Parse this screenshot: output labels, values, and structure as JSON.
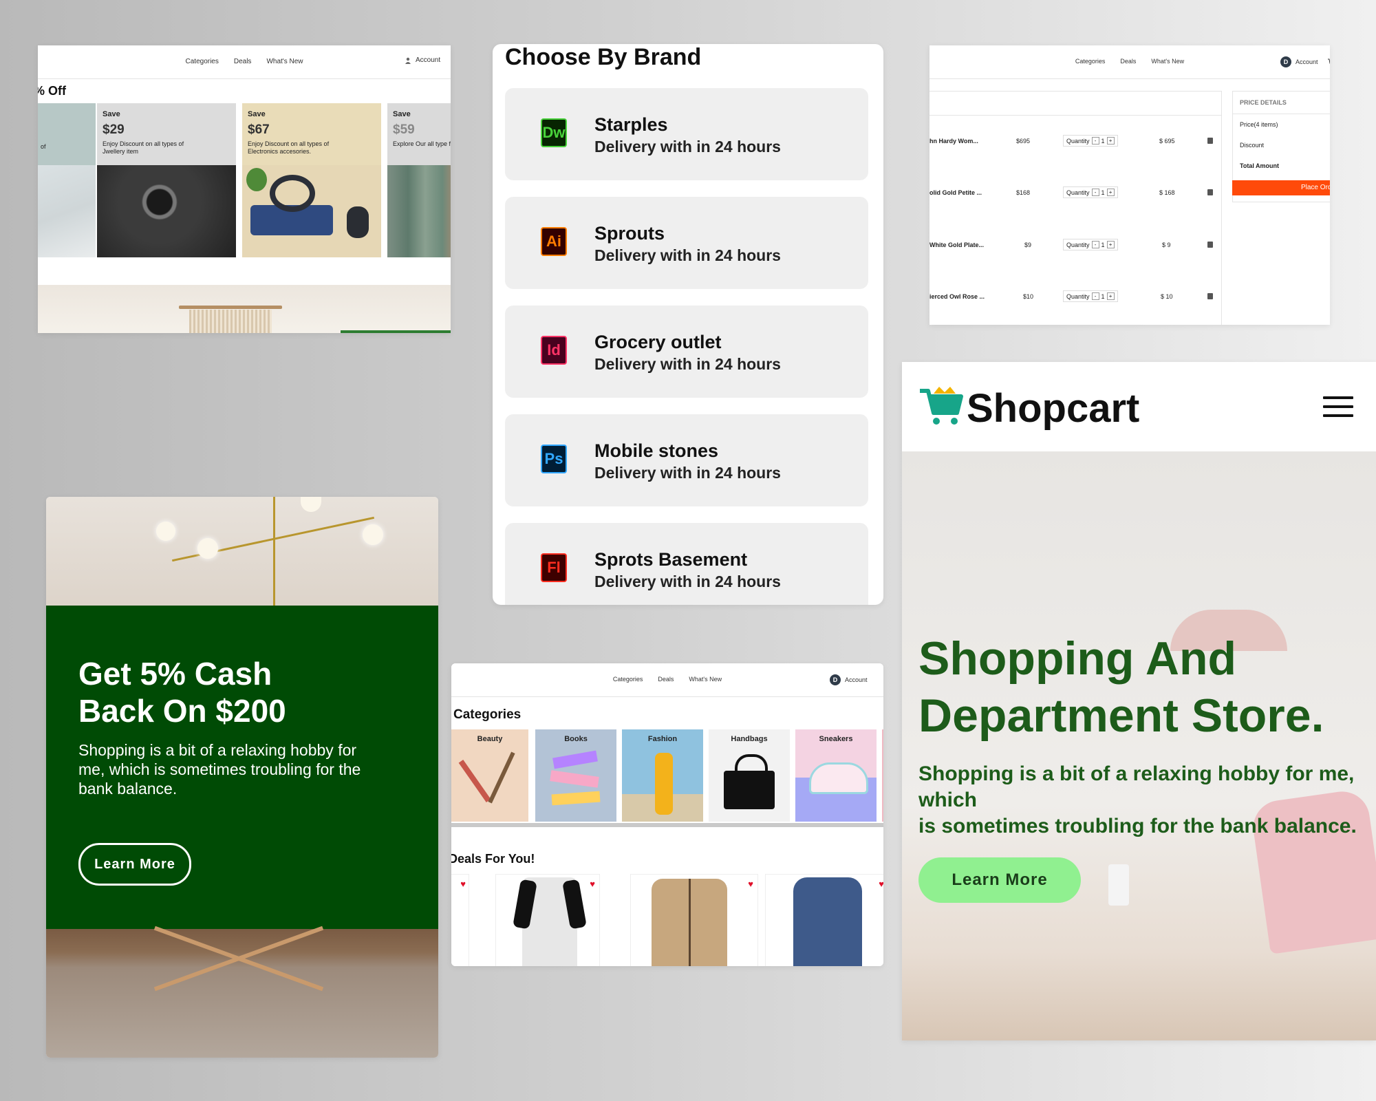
{
  "colors": {
    "hero_green": "#1d5c1a",
    "cashback_green": "#004b05",
    "learn_more_light": "#90f090",
    "place_order": "#ff4a0a",
    "heart": "#e0102a"
  },
  "nav": {
    "categories": "Categories",
    "deals": "Deals",
    "whats_new": "What's New",
    "account": "Account",
    "avatar_initial": "D"
  },
  "deals_card": {
    "off_label": "% Off",
    "partial_desc": "of",
    "deals": [
      {
        "save": "Save",
        "price": "$29",
        "desc": "Enjoy Discount on all types of Jwellery item",
        "image": "jewellery-photo"
      },
      {
        "save": "Save",
        "price": "$67",
        "desc": "Enjoy Discount on all types of Electronics accesories.",
        "image": "headphones-keyboard-photo"
      },
      {
        "save": "Save",
        "price": "$59",
        "desc": "Explore Our all type for Men",
        "image": "clothing-rack-photo"
      }
    ]
  },
  "brands_card": {
    "heading": "Choose By Brand",
    "brands": [
      {
        "icon": "Dw",
        "name": "Starples",
        "sub": "Delivery with in 24 hours",
        "color": "#48d13a",
        "bg": "#072401"
      },
      {
        "icon": "Ai",
        "name": "Sprouts",
        "sub": "Delivery with in 24 hours",
        "color": "#ff7c00",
        "bg": "#330000"
      },
      {
        "icon": "Id",
        "name": "Grocery outlet",
        "sub": "Delivery with in 24 hours",
        "color": "#ff3366",
        "bg": "#49021f"
      },
      {
        "icon": "Ps",
        "name": "Mobile stones",
        "sub": "Delivery with in 24 hours",
        "color": "#31a8ff",
        "bg": "#001e36"
      },
      {
        "icon": "Fl",
        "name": "Sprots Basement",
        "sub": "Delivery with in 24 hours",
        "color": "#ff2d20",
        "bg": "#3d0000"
      }
    ]
  },
  "cart_card": {
    "rows": [
      {
        "name": "hn Hardy Wom...",
        "price": "$695",
        "qty_label": "Quantity",
        "qty": "1",
        "total": "$ 695"
      },
      {
        "name": "olid Gold Petite ...",
        "price": "$168",
        "qty_label": "Quantity",
        "qty": "1",
        "total": "$ 168"
      },
      {
        "name": "White Gold Plate...",
        "price": "$9",
        "qty_label": "Quantity",
        "qty": "1",
        "total": "$ 9"
      },
      {
        "name": "ierced Owl Rose ...",
        "price": "$10",
        "qty_label": "Quantity",
        "qty": "1",
        "total": "$ 10"
      }
    ],
    "minus": "-",
    "plus": "+",
    "price_details": {
      "title": "PRICE DETAILS",
      "price_items": "Price(4 items)",
      "discount": "Discount",
      "total": "Total Amount",
      "place_order": "Place Orde"
    }
  },
  "shopcart_card": {
    "logo": "Shopcart",
    "headline": "Shopping And Department Store.",
    "sub_line1": "Shopping is a bit of a relaxing hobby for me, which",
    "sub_line2": "is sometimes troubling for the bank balance.",
    "cta": "Learn More"
  },
  "cashback_card": {
    "title_line1": "Get 5% Cash",
    "title_line2": "Back On $200",
    "desc": "Shopping is a bit of a relaxing hobby for me, which is sometimes troubling for the bank balance.",
    "cta": "Learn More"
  },
  "categories_card": {
    "heading": "Categories",
    "categories": [
      {
        "label": "Beauty",
        "bg": "#f1d7c1"
      },
      {
        "label": "Books",
        "bg": "#b3c3d6"
      },
      {
        "label": "Fashion",
        "bg": "#8fc2df"
      },
      {
        "label": "Handbags",
        "bg": "#f2f2f2"
      },
      {
        "label": "Sneakers",
        "bg": "#f4d3e2"
      }
    ],
    "deals_heading": "Deals For You!",
    "heart": "♥"
  }
}
